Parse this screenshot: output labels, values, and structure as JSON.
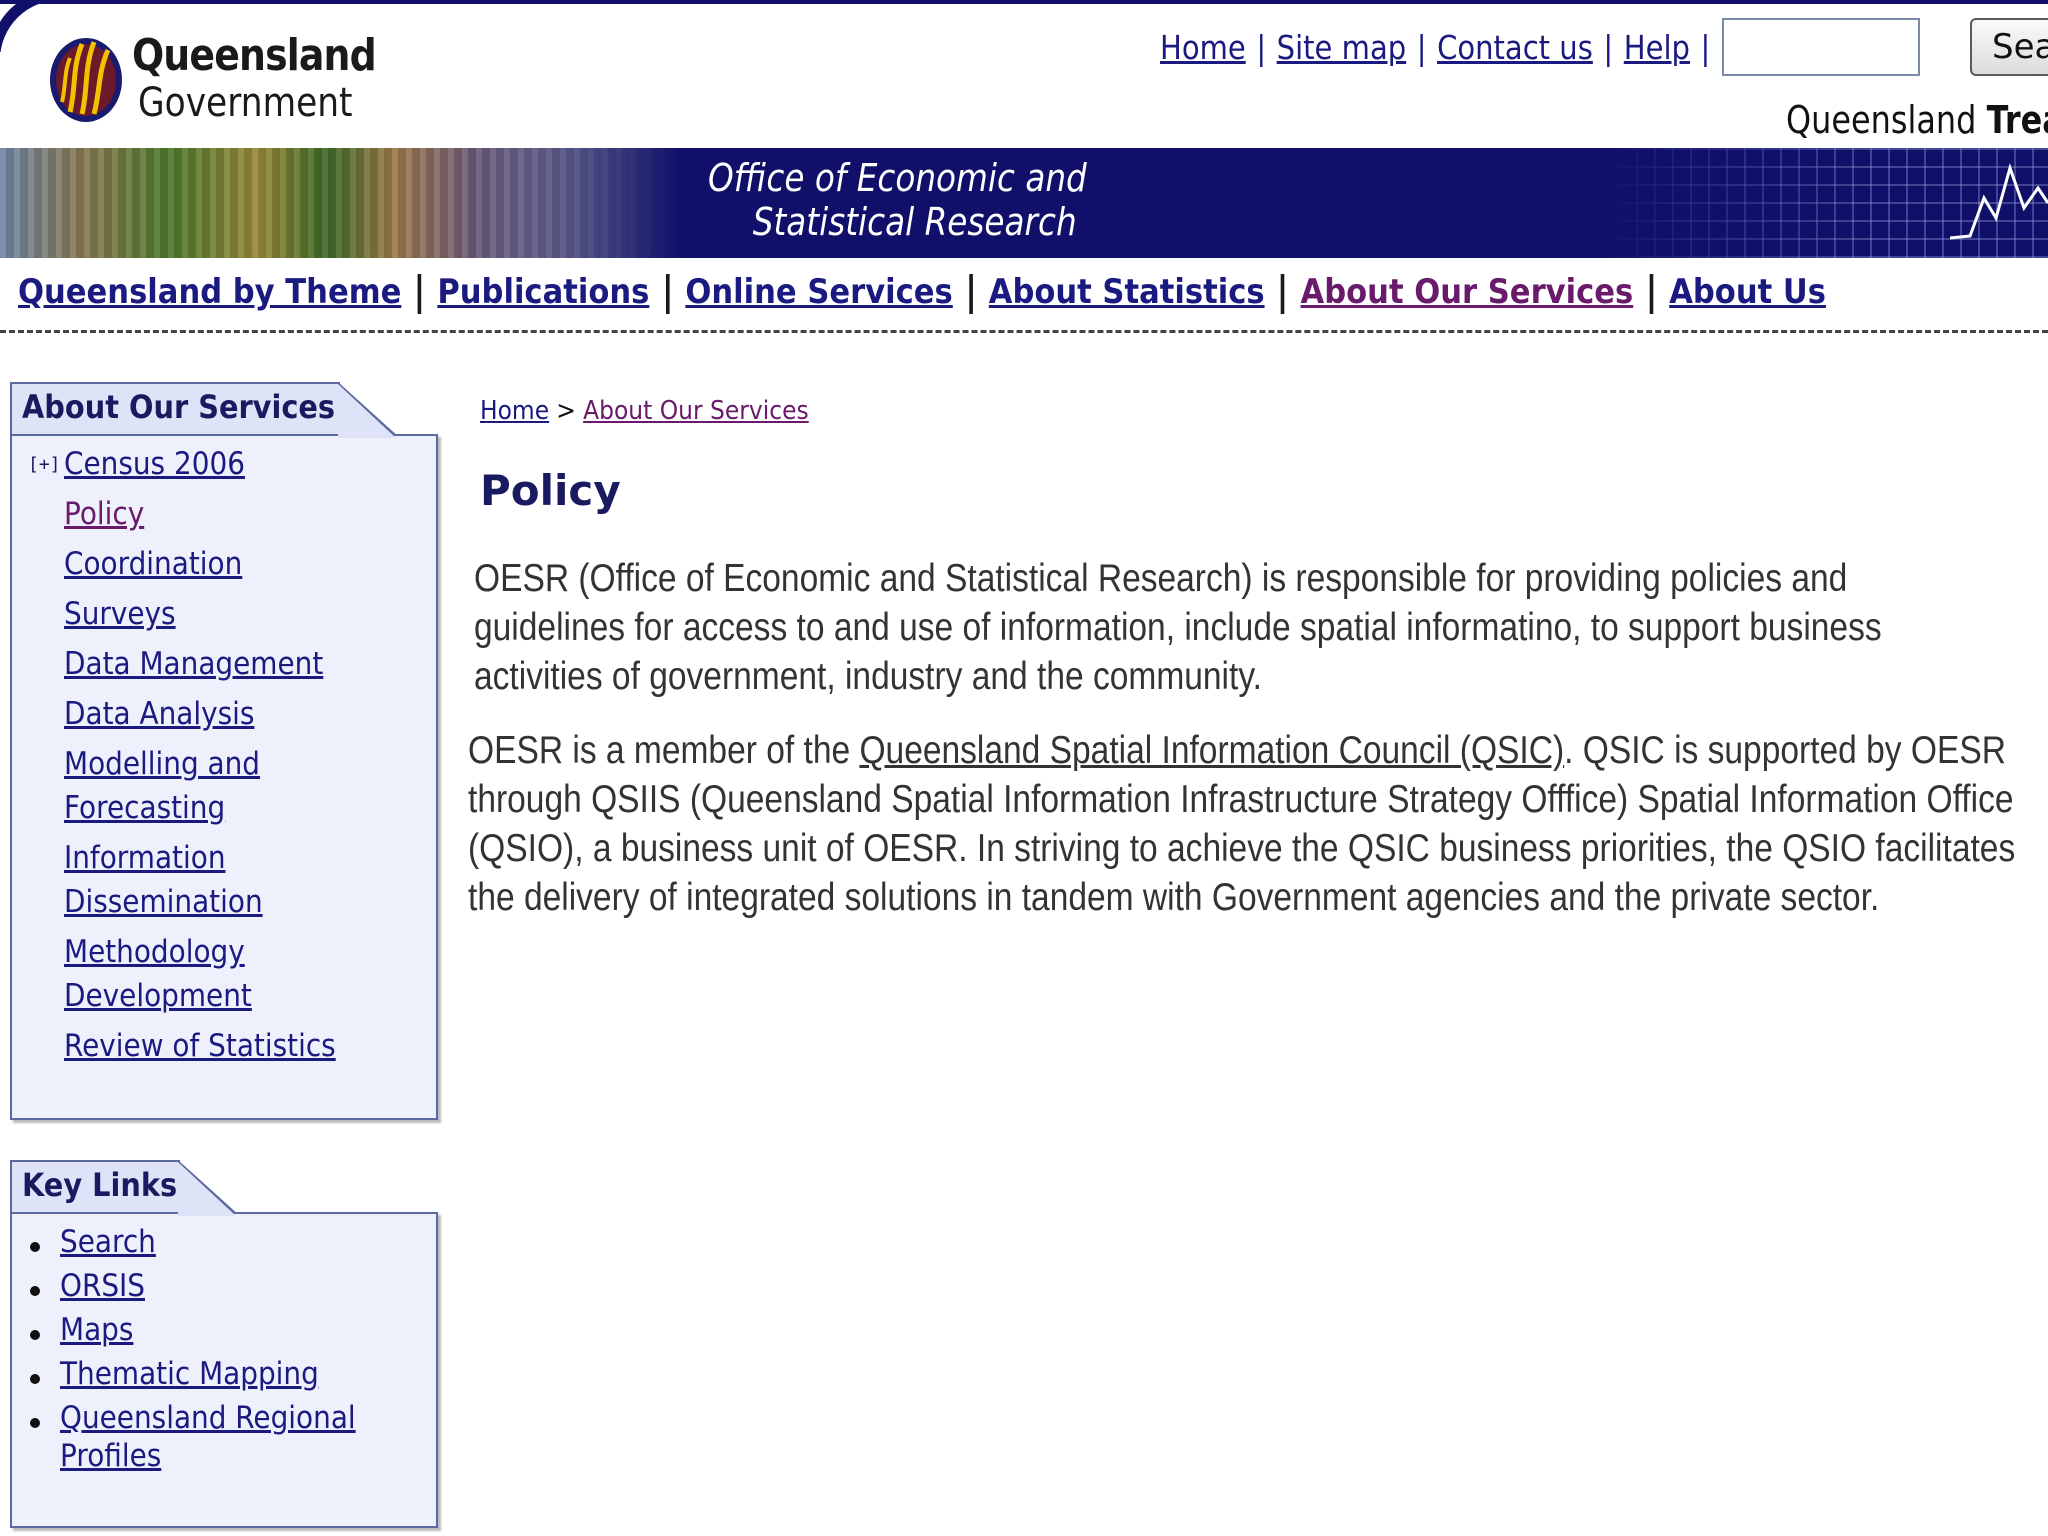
{
  "header": {
    "logo_line1": "Queensland",
    "logo_line2": "Government",
    "util_nav": [
      "Home",
      "Site map",
      "Contact us",
      "Help"
    ],
    "search_placeholder": "",
    "search_button": "Sea",
    "agency_prefix": "Queensland ",
    "agency_bold": "Treas"
  },
  "banner": {
    "title_line1": "Office of Economic and",
    "title_line2": "Statistical Research"
  },
  "main_nav": [
    "Queensland by Theme",
    "Publications",
    "Online Services",
    "About Statistics",
    "About Our Services",
    "About Us"
  ],
  "sidebar": {
    "title": "About Our Services",
    "expander": "[+]",
    "items": [
      "Census 2006",
      "Policy",
      "Coordination",
      "Surveys",
      "Data Management",
      "Data Analysis",
      "Modelling and",
      "Forecasting",
      "Information",
      "Dissemination",
      "Methodology",
      "Development",
      "Review of Statistics"
    ]
  },
  "key_links": {
    "title": "Key Links",
    "items": [
      "Search",
      "ORSIS",
      "Maps",
      "Thematic Mapping",
      "Queensland Regional",
      "Profiles"
    ]
  },
  "breadcrumb": {
    "home": "Home",
    "sep": ">",
    "current": "About Our Services"
  },
  "content": {
    "title": "Policy",
    "p1": [
      "OESR (Office of Economic and Statistical Research) is responsible for providing policies and",
      "guidelines for access to and use of information, include spatial informatino, to support business",
      "activities of government, industry and the community."
    ],
    "p2_start": "OESR is a member of the ",
    "p2_link": "Queensland Spatial Information Council (QSIC)",
    "p2_end": ". QSIC is supported by OESR",
    "p2_lines": [
      "through QSIIS (Queensland Spatial Information Infrastructure Strategy Offfice) Spatial Information Office",
      "(QSIO), a business unit of OESR. In striving to achieve the QSIC business priorities, the QSIO  facilitates",
      "the delivery of integrated solutions in tandem with Government agencies and the private sector."
    ]
  },
  "colors": {
    "navy": "#10106a",
    "link": "#1a1a80",
    "visited": "#6a1a6a",
    "sidebar_bg": "#eef0fc"
  }
}
